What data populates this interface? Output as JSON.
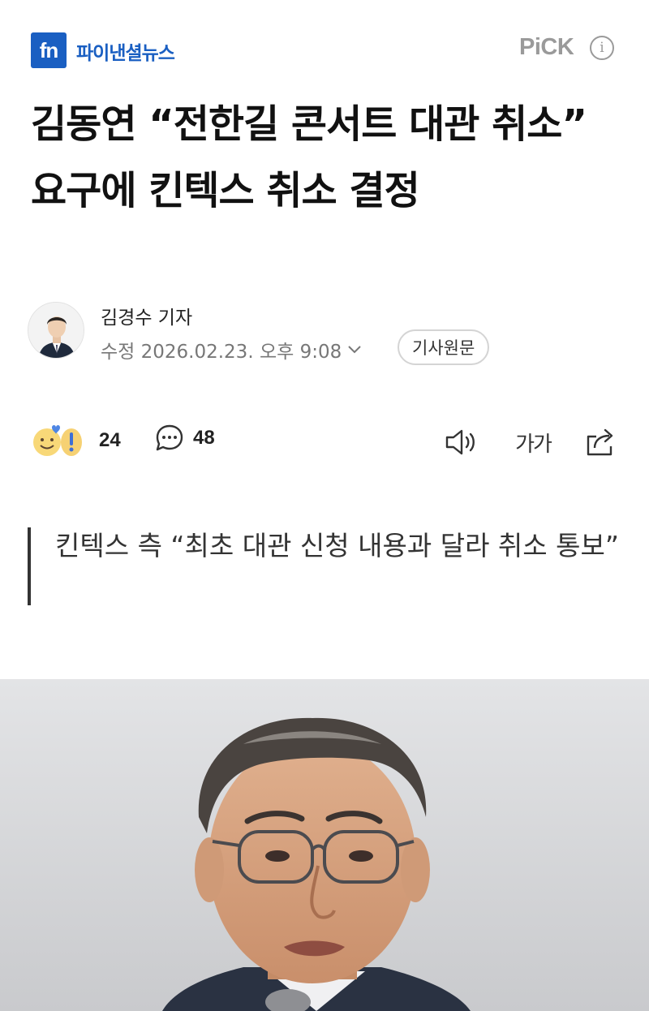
{
  "header": {
    "logo_mark": "fn",
    "logo_name": "파이낸셜뉴스",
    "pick_label": "PiCK",
    "info_icon": "info-circle-icon"
  },
  "article": {
    "headline": "김동연 “전한길 콘서트 대관 취소” 요구에 킨텍스 취소 결정",
    "reporter": "김경수 기자",
    "modified": "수정 2026.02.23. 오후 9:08",
    "original_button": "기사원문",
    "subtitle": "킨텍스 측 “최초 대관 신청 내용과 달라 취소 통보”"
  },
  "actions": {
    "reaction_count": "24",
    "comment_count": "48",
    "font_size_label": "가가",
    "icons": [
      "reaction-emoji-icon",
      "comment-icon",
      "speaker-icon",
      "font-size-icon",
      "share-icon"
    ]
  },
  "colors": {
    "brand": "#1a5fc2",
    "pick": "#9a9a9a"
  }
}
